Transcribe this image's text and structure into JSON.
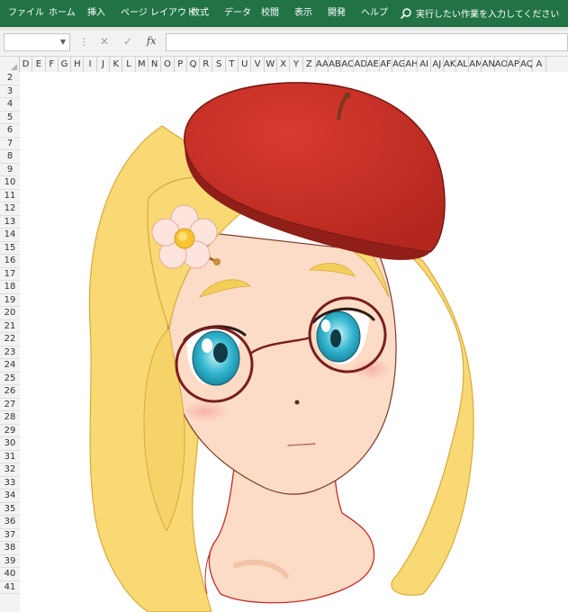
{
  "ribbon": {
    "tabs": [
      "ファイル",
      "ホーム",
      "挿入",
      "ページ レイアウト",
      "数式",
      "データ",
      "校閲",
      "表示",
      "開発",
      "ヘルプ"
    ],
    "tell_me": "実行したい作業を入力してください",
    "color": "#217346"
  },
  "formula_bar": {
    "name_box_value": "",
    "dots": "⋮",
    "cancel": "✕",
    "enter": "✓",
    "fx": "fx",
    "formula_value": ""
  },
  "columns": [
    "D",
    "E",
    "F",
    "G",
    "H",
    "I",
    "J",
    "K",
    "L",
    "M",
    "N",
    "O",
    "P",
    "Q",
    "R",
    "S",
    "T",
    "U",
    "V",
    "W",
    "X",
    "Y",
    "Z",
    "AA",
    "AB",
    "AC",
    "AD",
    "AE",
    "AF",
    "AG",
    "AH",
    "AI",
    "AJ",
    "AK",
    "AL",
    "AM",
    "AN",
    "AO",
    "AP",
    "AQ",
    "A"
  ],
  "rows": [
    "2",
    "3",
    "4",
    "5",
    "6",
    "7",
    "8",
    "9",
    "10",
    "11",
    "12",
    "13",
    "14",
    "15",
    "16",
    "17",
    "18",
    "19",
    "20",
    "21",
    "22",
    "23",
    "24",
    "25",
    "26",
    "27",
    "28",
    "29",
    "30",
    "31",
    "32",
    "33",
    "34",
    "35",
    "36",
    "37",
    "38",
    "39",
    "40",
    "41"
  ],
  "illustration": {
    "hair_color": "#f8d974",
    "skin_color": "#fcdcc6",
    "beret_color": "#cc3228",
    "eye_color": "#35b7cf",
    "glasses_color": "#7a1e1e"
  }
}
